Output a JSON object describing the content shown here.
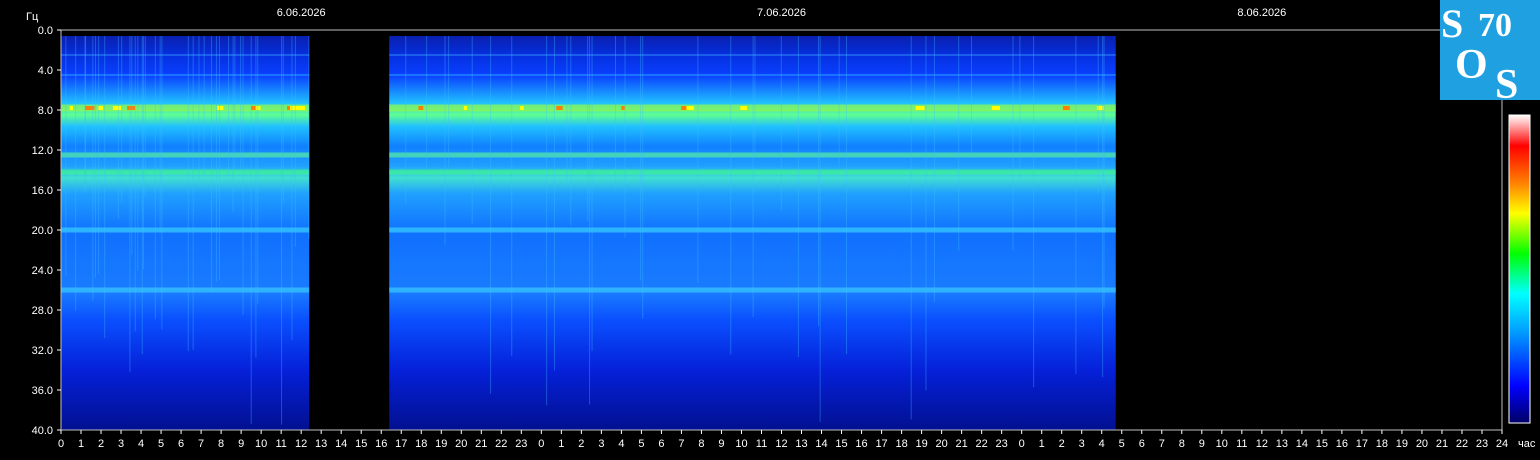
{
  "chart_data": {
    "type": "heatmap",
    "title": "",
    "ylabel": "Гц",
    "xlabel": "час",
    "ylim": [
      0,
      40
    ],
    "y_ticks": [
      "0.0",
      "4.0",
      "8.0",
      "12.0",
      "16.0",
      "20.0",
      "24.0",
      "28.0",
      "32.0",
      "36.0",
      "40.0"
    ],
    "x_ticks": [
      "0",
      "1",
      "2",
      "3",
      "4",
      "5",
      "6",
      "7",
      "8",
      "9",
      "10",
      "11",
      "12",
      "13",
      "14",
      "15",
      "16",
      "17",
      "18",
      "19",
      "20",
      "21",
      "22",
      "23",
      "0",
      "1",
      "2",
      "3",
      "4",
      "5",
      "6",
      "7",
      "8",
      "9",
      "10",
      "11",
      "12",
      "13",
      "14",
      "15",
      "16",
      "17",
      "18",
      "19",
      "20",
      "21",
      "22",
      "23",
      "0",
      "1",
      "2",
      "3",
      "4",
      "5",
      "6",
      "7",
      "8",
      "9",
      "10",
      "11",
      "12",
      "13",
      "14",
      "15",
      "16",
      "17",
      "18",
      "19",
      "20",
      "21",
      "22",
      "23",
      "24"
    ],
    "dates": [
      "6.06.2026",
      "7.06.2026",
      "8.06.2026"
    ],
    "x_range_hours": [
      0,
      72
    ],
    "data_segments_hours": [
      [
        0,
        12.4
      ],
      [
        16.4,
        52.7
      ]
    ],
    "gap_segments_hours": [
      [
        12.4,
        16.4
      ],
      [
        52.7,
        72
      ]
    ],
    "resonance_bands_hz": [
      2.5,
      4.5,
      7.8,
      12.5,
      14.2,
      20.0,
      26.0
    ],
    "intensity_colorscale": [
      "#000066",
      "#0000ff",
      "#00a0ff",
      "#00ffff",
      "#00ff00",
      "#ffff00",
      "#ff8000",
      "#ff0000",
      "#ffffff"
    ]
  },
  "logo": {
    "letters": [
      "S",
      "O",
      "S"
    ],
    "number": "70",
    "bg_color": "#1fa0e0"
  }
}
